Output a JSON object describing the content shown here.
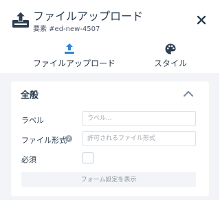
{
  "header": {
    "title": "ファイルアップロード",
    "subtitle": "要素 #ed-new-4507",
    "icon": "upload-tray-icon",
    "close_icon": "close-icon"
  },
  "tabs": [
    {
      "label": "ファイルアップロード",
      "icon": "upload-icon",
      "active": true
    },
    {
      "label": "スタイル",
      "icon": "palette-icon",
      "active": false
    }
  ],
  "section": {
    "title": "全般",
    "collapsed": false
  },
  "fields": {
    "label": {
      "label": "ラベル",
      "placeholder": "ラベル..."
    },
    "file_format": {
      "label": "ファイル形式",
      "placeholder": "許可されるファイル形式",
      "help_icon": "help-icon"
    },
    "required": {
      "label": "必須",
      "checked": false
    }
  },
  "buttons": {
    "form_settings": "フォーム設定を表示"
  },
  "colors": {
    "accent": "#2f86d6",
    "text": "#2c3e50",
    "panel_bg": "#f2f4f7"
  }
}
